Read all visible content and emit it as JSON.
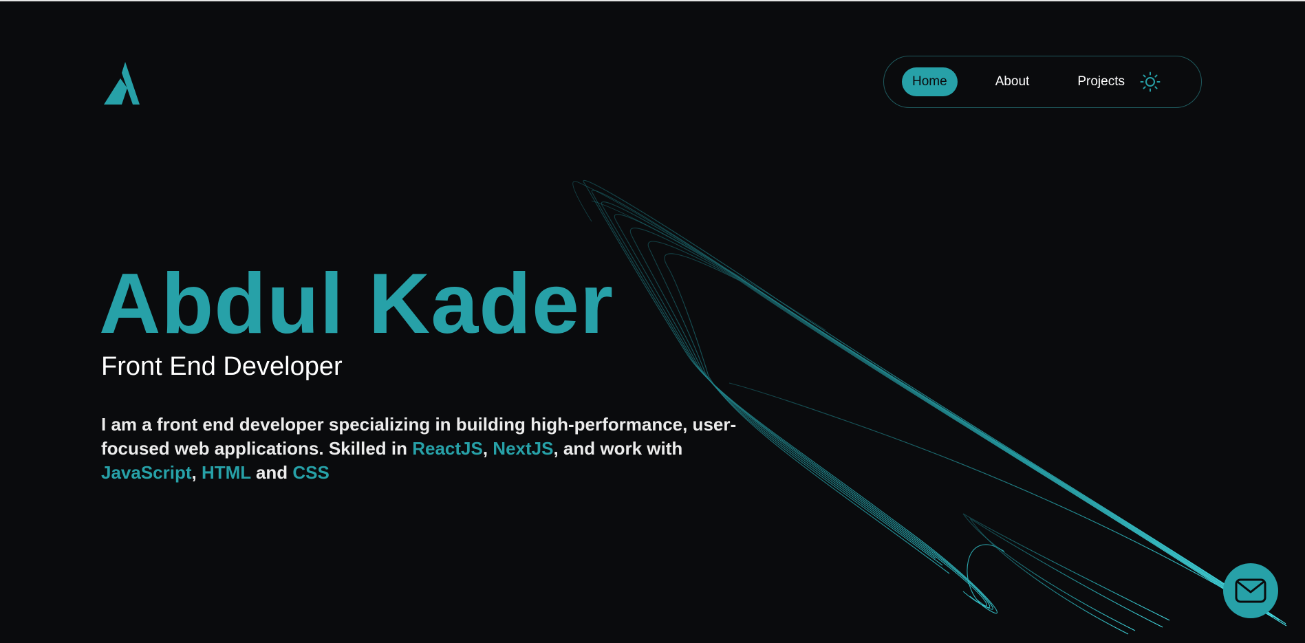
{
  "brand": {
    "logo_icon": "stylized-a-logo-icon",
    "accent_color": "#27a1a8",
    "background_color": "#0a0b0d"
  },
  "nav": {
    "items": [
      {
        "label": "Home",
        "active": true
      },
      {
        "label": "About",
        "active": false
      },
      {
        "label": "Projects",
        "active": false
      }
    ],
    "theme_toggle_icon": "sun-icon"
  },
  "hero": {
    "name": "Abdul Kader",
    "role": "Front End Developer",
    "description": {
      "part1": "I am a front end developer specializing in building high-performance, user-focused web applications. Skilled in ",
      "skill_react": "ReactJS",
      "sep1": ", ",
      "skill_next": "NextJS",
      "part2": ", and work with ",
      "skill_js": "JavaScript",
      "sep2": ", ",
      "skill_html": "HTML",
      "sep3": " and ",
      "skill_css": "CSS"
    }
  },
  "contact": {
    "icon": "mail-icon"
  }
}
